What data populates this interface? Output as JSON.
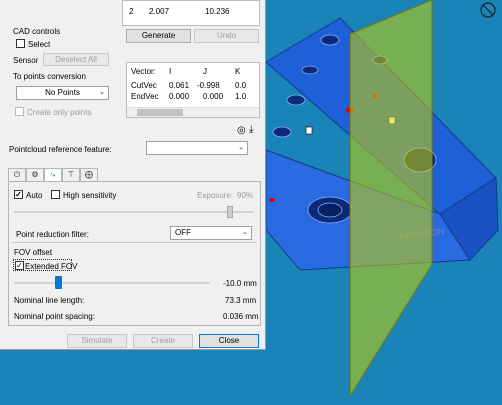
{
  "points_table": {
    "row": {
      "index": "2",
      "value1": "2.007",
      "value2": "10.236"
    }
  },
  "cad_controls": {
    "title": "CAD controls",
    "select_label": "Select",
    "sensor_label": "Sensor",
    "deselect_all_label": "Deselect All"
  },
  "generate_label": "Generate",
  "undo_label": "Undo",
  "vector_table": {
    "headers": [
      "Vector:",
      "I",
      "J",
      "K"
    ],
    "rows": [
      {
        "name": "CutVec",
        "i": "0.061",
        "j": "-0.998",
        "k": "0.0"
      },
      {
        "name": "EndVec",
        "i": "0.000",
        "j": "0.000",
        "k": "1.0"
      }
    ]
  },
  "points_conversion": {
    "title": "To points conversion",
    "selected": "No Points",
    "create_only_points_label": "Create only points"
  },
  "pointcloud_ref": {
    "label": "Pointcloud reference feature:",
    "value": ""
  },
  "settings": {
    "auto_label": "Auto",
    "high_sensitivity_label": "High sensitivity",
    "exposure_label": "Exposure:",
    "exposure_value": "90%",
    "exposure_level": 0.9,
    "point_reduction_label": "Point reduction filter:",
    "point_reduction_value": "OFF",
    "fov_offset_title": "FOV offset",
    "extended_fov_label": "Extended FOV",
    "fov_value": "-10.0 mm",
    "nominal_line_length_label": "Nominal line length:",
    "nominal_line_length_value": "73.3 mm",
    "nominal_point_spacing_label": "Nominal point spacing:",
    "nominal_point_spacing_value": "0.036 mm"
  },
  "footer": {
    "simulate_label": "Simulate",
    "create_label": "Create",
    "close_label": "Close"
  },
  "cad_labels": {
    "brand": "HEXAGON"
  },
  "colors": {
    "viewport_bg": "#1a84b8",
    "part": "#1e5fd6",
    "plane": "#c8d400",
    "accent": "#0078d7"
  }
}
